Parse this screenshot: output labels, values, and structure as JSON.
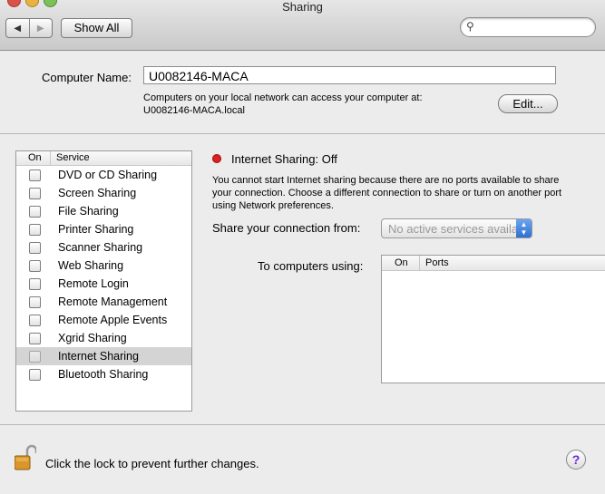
{
  "window": {
    "title": "Sharing"
  },
  "toolbar": {
    "back_icon": "◀",
    "forward_icon": "▶",
    "show_all": "Show All",
    "search_placeholder": "",
    "search_value": ""
  },
  "computer": {
    "label": "Computer Name:",
    "name": "U0082146-MACA",
    "note_line1": "Computers on your local network can access your computer at:",
    "note_line2": "U0082146-MACA.local",
    "edit_button": "Edit..."
  },
  "services": {
    "header_on": "On",
    "header_service": "Service",
    "items": [
      {
        "label": "DVD or CD Sharing",
        "checked": false
      },
      {
        "label": "Screen Sharing",
        "checked": false
      },
      {
        "label": "File Sharing",
        "checked": false
      },
      {
        "label": "Printer Sharing",
        "checked": false
      },
      {
        "label": "Scanner Sharing",
        "checked": false
      },
      {
        "label": "Web Sharing",
        "checked": false
      },
      {
        "label": "Remote Login",
        "checked": false
      },
      {
        "label": "Remote Management",
        "checked": false
      },
      {
        "label": "Remote Apple Events",
        "checked": false
      },
      {
        "label": "Xgrid Sharing",
        "checked": false
      },
      {
        "label": "Internet Sharing",
        "checked": false,
        "selected": true
      },
      {
        "label": "Bluetooth Sharing",
        "checked": false
      }
    ]
  },
  "detail": {
    "status": "Internet Sharing: Off",
    "status_color": "#dd2222",
    "description": "You cannot start Internet sharing because there are no ports available to share your connection. Choose a different connection to share or turn on another port using Network preferences.",
    "share_from_label": "Share your connection from:",
    "share_from_value": "No active services available",
    "to_computers_label": "To computers using:",
    "ports_header_on": "On",
    "ports_header_ports": "Ports"
  },
  "footer": {
    "lock_text": "Click the lock to prevent further changes.",
    "help": "?"
  }
}
